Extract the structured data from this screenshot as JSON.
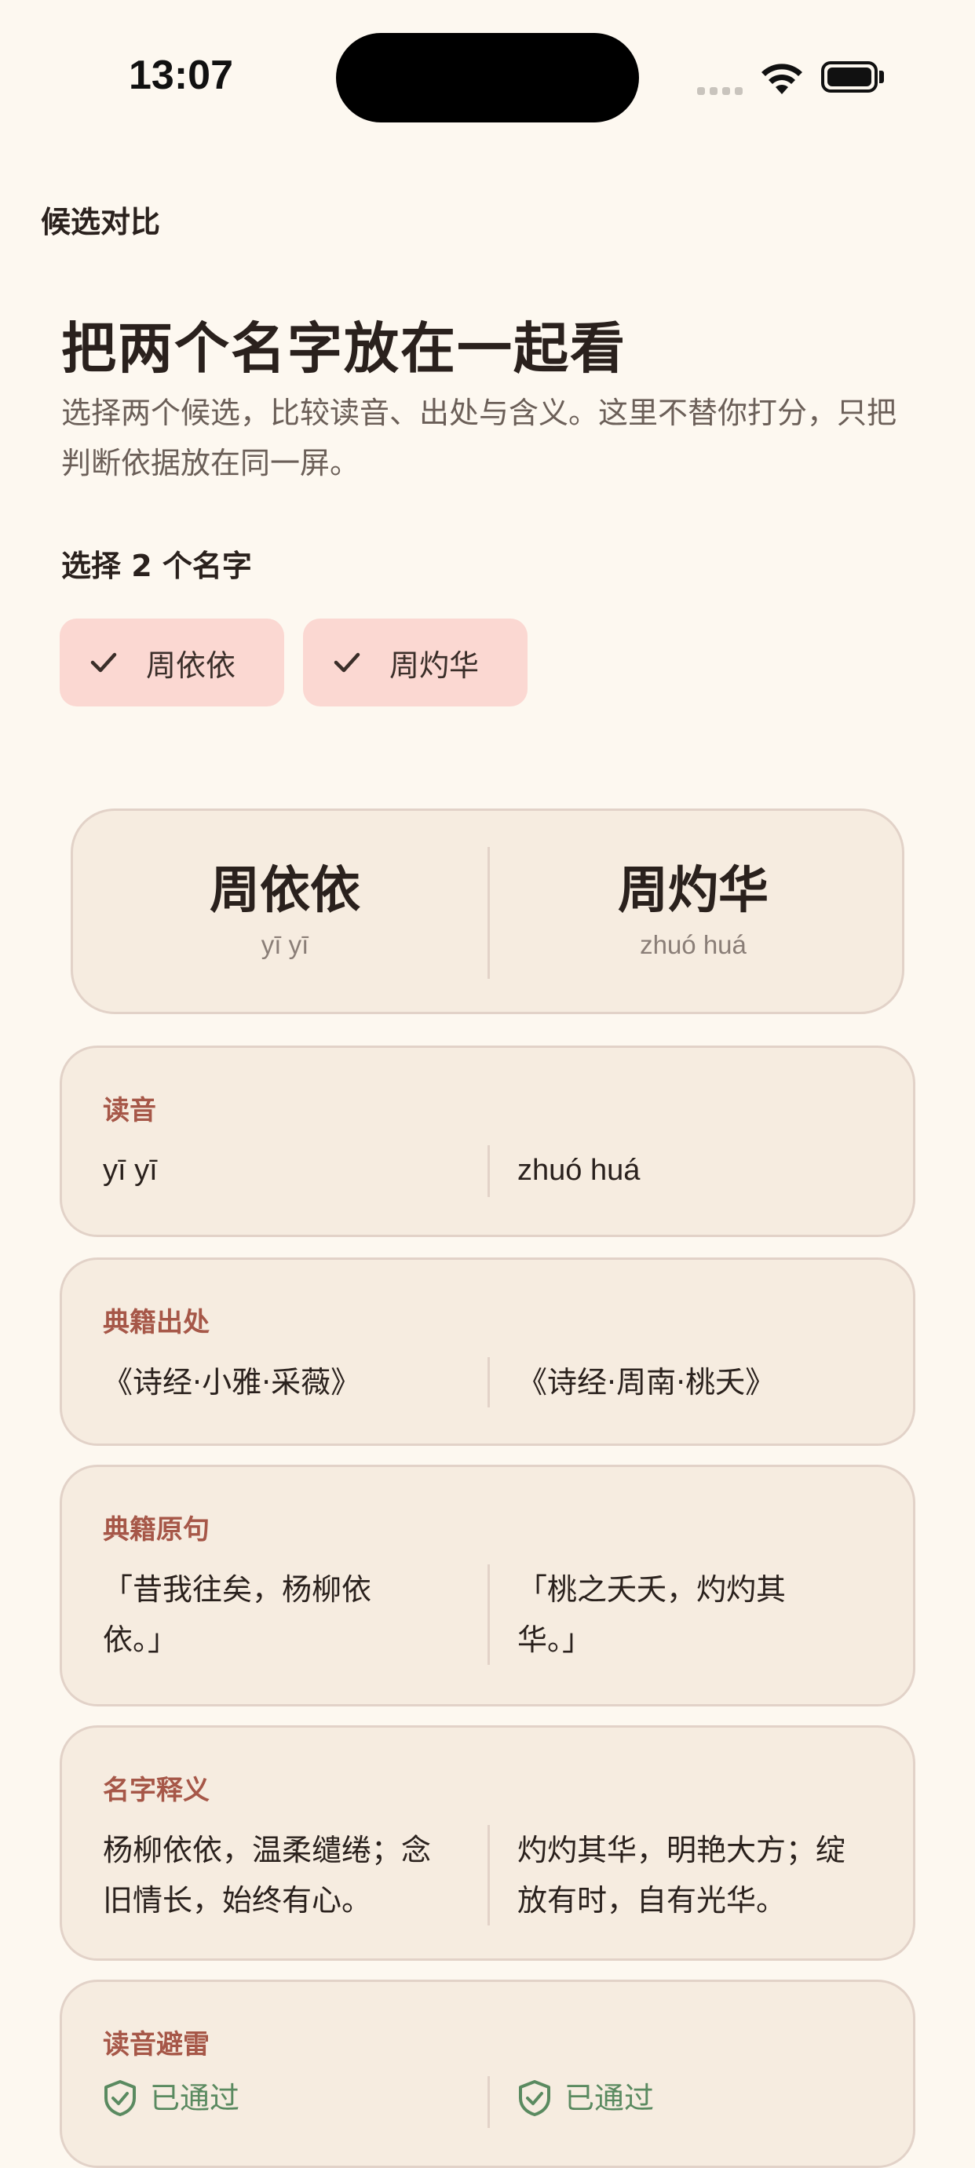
{
  "status_bar": {
    "time": "13:07"
  },
  "nav": {
    "title": "候选对比"
  },
  "header": {
    "headline": "把两个名字放在一起看",
    "subtitle": "选择两个候选，比较读音、出处与含义。这里不替你打分，只把判断依据放在同一屏。"
  },
  "selection": {
    "label": "选择 2 个名字",
    "chips": [
      {
        "label": "周依依",
        "selected": true
      },
      {
        "label": "周灼华",
        "selected": true
      }
    ]
  },
  "summary": {
    "left": {
      "name": "周依依",
      "pinyin": "yī yī"
    },
    "right": {
      "name": "周灼华",
      "pinyin": "zhuó huá"
    }
  },
  "rows": [
    {
      "label": "读音",
      "left": "yī yī",
      "right": "zhuó huá"
    },
    {
      "label": "典籍出处",
      "left": "《诗经·小雅·采薇》",
      "right": "《诗经·周南·桃夭》"
    },
    {
      "label": "典籍原句",
      "left": "「昔我往矣，杨柳依依。」",
      "right": "「桃之夭夭，灼灼其华。」"
    },
    {
      "label": "名字释义",
      "left": "杨柳依依，温柔缱绻；念旧情长，始终有心。",
      "right": "灼灼其华，明艳大方；绽放有时，自有光华。"
    },
    {
      "label": "读音避雷",
      "left": "已通过",
      "right": "已通过"
    }
  ],
  "colors": {
    "background": "#fdf8f0",
    "card": "#f6ece0",
    "accent_label": "#a65748",
    "chip_selected": "#fbd8d2",
    "pass_green": "#5a8a60"
  }
}
